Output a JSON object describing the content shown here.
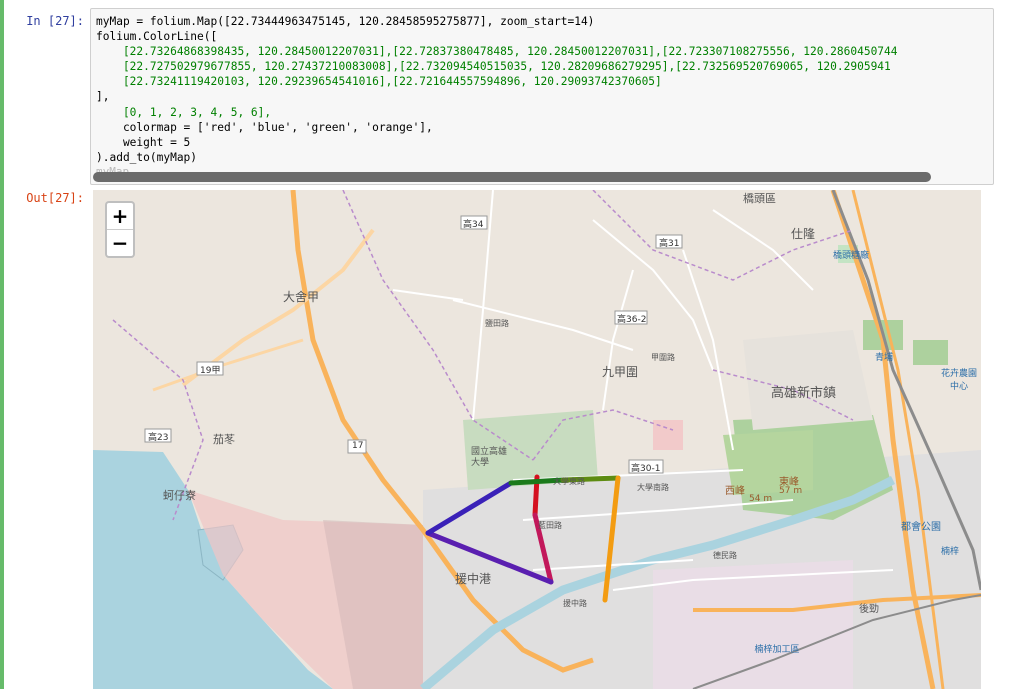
{
  "notebook": {
    "input_prompt": "In [27]:",
    "output_prompt": "Out[27]:",
    "code_lines": [
      "myMap = folium.Map([22.73444963475145, 120.28458595275877], zoom_start=14)",
      "folium.ColorLine([",
      "    [22.73264868398435, 120.28450012207031],[22.72837380478485, 120.28450012207031],[22.723307108275556, 120.2860450744",
      "    [22.727502979677855, 120.27437210083008],[22.732094540515035, 120.28209686279295],[22.732569520769065, 120.2905941",
      "    [22.73241119420103, 120.29239654541016],[22.721644557594896, 120.29093742370605]",
      "],",
      "    [0, 1, 2, 3, 4, 5, 6],",
      "    colormap = ['red', 'blue', 'green', 'orange'],",
      "    weight = 5",
      ").add_to(myMap)"
    ],
    "ghost_text": "myMap"
  },
  "map": {
    "zoom_in": "+",
    "zoom_out": "−",
    "place_labels": [
      "橋頭區",
      "仕隆",
      "橋頭糖廠",
      "大舍甲",
      "九甲圍",
      "高雄新市鎮",
      "國立高雄大學",
      "援中港",
      "蚵仔寮",
      "茄苳",
      "東峰",
      "西峰",
      "都會公園",
      "後勁",
      "楠梓加工區",
      "花卉農園中心",
      "青埔",
      "楠梓"
    ],
    "road_shields": [
      "高34",
      "高31",
      "高36-2",
      "19甲",
      "高23",
      "17",
      "高30-1"
    ],
    "road_names": [
      "鹽田路",
      "藍田路",
      "大學南路",
      "援中路",
      "德民路",
      "甲圍路",
      "大學東路"
    ],
    "elevations": [
      "57 m",
      "54 m"
    ],
    "polyline_colors": [
      "#d4101f",
      "#c2185b",
      "#5a1fb0",
      "#3a21b8",
      "#1b7a1b",
      "#5e8c12",
      "#f39c12"
    ]
  }
}
